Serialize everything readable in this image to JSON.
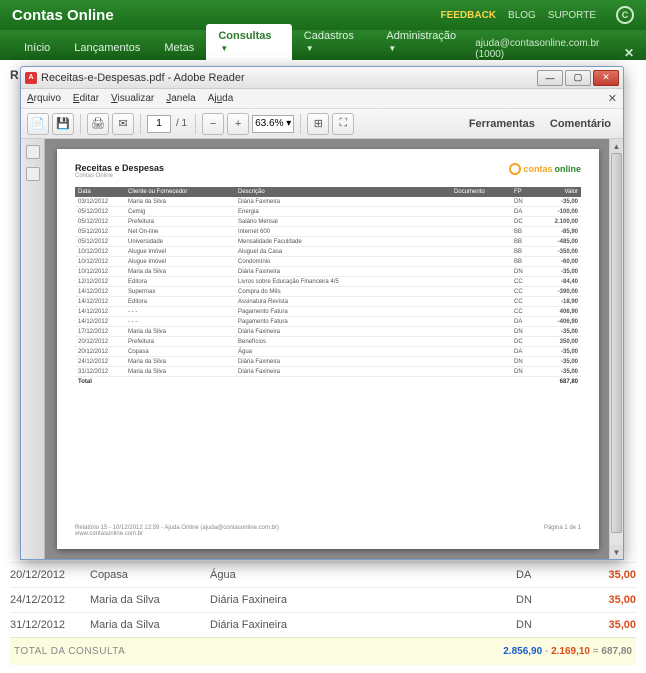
{
  "header": {
    "app_title": "Contas Online",
    "links": {
      "feedback": "FEEDBACK",
      "blog": "BLOG",
      "suporte": "SUPORTE"
    }
  },
  "nav": {
    "items": [
      {
        "label": "Início"
      },
      {
        "label": "Lançamentos"
      },
      {
        "label": "Metas"
      },
      {
        "label": "Consultas",
        "active": true,
        "dd": true
      },
      {
        "label": "Cadastros",
        "dd": true
      },
      {
        "label": "Administração",
        "dd": true
      }
    ],
    "user": "ajuda@contasonline.com.br (1000)"
  },
  "page": {
    "title_prefix": "R"
  },
  "bg_rows": [
    {
      "date": "20/12/2012",
      "who": "Copasa",
      "desc": "Água",
      "fp": "DA",
      "val": "35,00"
    },
    {
      "date": "24/12/2012",
      "who": "Maria da Silva",
      "desc": "Diária Faxineira",
      "fp": "DN",
      "val": "35,00"
    },
    {
      "date": "31/12/2012",
      "who": "Maria da Silva",
      "desc": "Diária Faxineira",
      "fp": "DN",
      "val": "35,00"
    }
  ],
  "total": {
    "label": "TOTAL DA CONSULTA",
    "pos": "2.856,90",
    "sep1": " - ",
    "neg": "2.169,10",
    "sep2": " = ",
    "tot": "687,80"
  },
  "pdf": {
    "title": "Receitas-e-Despesas.pdf - Adobe Reader",
    "menu": {
      "arquivo": "Arquivo",
      "editar": "Editar",
      "visualizar": "Visualizar",
      "janela": "Janela",
      "ajuda": "Ajuda"
    },
    "page_current": "1",
    "page_total": "/ 1",
    "zoom": "63.6%",
    "tb": {
      "ferramentas": "Ferramentas",
      "comentario": "Comentário"
    },
    "paper": {
      "title": "Receitas e Despesas",
      "sub": "Contas Online",
      "headers": {
        "data": "Data",
        "cliente": "Cliente ou Fornecedor",
        "desc": "Descrição",
        "doc": "Documento",
        "fp": "FP",
        "valor": "Valor"
      },
      "rows": [
        {
          "d": "03/12/2012",
          "c": "Maria da Silva",
          "desc": "Diária Faxineira",
          "doc": "",
          "fp": "DN",
          "v": "-35,00",
          "cls": "v-red"
        },
        {
          "d": "05/12/2012",
          "c": "Cemig",
          "desc": "Energia",
          "doc": "",
          "fp": "DA",
          "v": "-100,00",
          "cls": "v-red"
        },
        {
          "d": "05/12/2012",
          "c": "Prefeitura",
          "desc": "Salário Mensal",
          "doc": "",
          "fp": "DC",
          "v": "2.100,00",
          "cls": "v-blue"
        },
        {
          "d": "05/12/2012",
          "c": "Net On-line",
          "desc": "Internet 600",
          "doc": "",
          "fp": "BB",
          "v": "-85,90",
          "cls": "v-red"
        },
        {
          "d": "05/12/2012",
          "c": "Universidade",
          "desc": "Mensalidade Faculdade",
          "doc": "",
          "fp": "BB",
          "v": "-485,00",
          "cls": "v-red"
        },
        {
          "d": "10/12/2012",
          "c": "Alugue Imóvel",
          "desc": "Aluguel da Casa",
          "doc": "",
          "fp": "BB",
          "v": "-350,00",
          "cls": "v-red"
        },
        {
          "d": "10/12/2012",
          "c": "Alugue Imóvel",
          "desc": "Condomínio",
          "doc": "",
          "fp": "BB",
          "v": "-60,00",
          "cls": "v-red"
        },
        {
          "d": "10/12/2012",
          "c": "Maria da Silva",
          "desc": "Diária Faxineira",
          "doc": "",
          "fp": "DN",
          "v": "-35,00",
          "cls": "v-red"
        },
        {
          "d": "12/12/2012",
          "c": "Editora",
          "desc": "Livros sobre Educação Financeira 4/5",
          "doc": "",
          "fp": "CC",
          "v": "-84,40",
          "cls": "v-red"
        },
        {
          "d": "14/12/2012",
          "c": "Supermax",
          "desc": "Compra do Mês",
          "doc": "",
          "fp": "CC",
          "v": "-390,00",
          "cls": "v-red"
        },
        {
          "d": "14/12/2012",
          "c": "Editora",
          "desc": "Assinatura Revista",
          "doc": "",
          "fp": "CC",
          "v": "-18,90",
          "cls": "v-red"
        },
        {
          "d": "14/12/2012",
          "c": "- - -",
          "desc": "Pagamento Fatura",
          "doc": "",
          "fp": "CC",
          "v": "406,90",
          "cls": "v-blue"
        },
        {
          "d": "14/12/2012",
          "c": "- - -",
          "desc": "Pagamento Fatura",
          "doc": "",
          "fp": "DA",
          "v": "-406,90",
          "cls": "v-red"
        },
        {
          "d": "17/12/2012",
          "c": "Maria da Silva",
          "desc": "Diária Faxineira",
          "doc": "",
          "fp": "DN",
          "v": "-35,00",
          "cls": "v-red"
        },
        {
          "d": "20/12/2012",
          "c": "Prefeitura",
          "desc": "Benefícios",
          "doc": "",
          "fp": "DC",
          "v": "350,00",
          "cls": "v-blue"
        },
        {
          "d": "20/12/2012",
          "c": "Copasa",
          "desc": "Água",
          "doc": "",
          "fp": "DA",
          "v": "-35,00",
          "cls": "v-red"
        },
        {
          "d": "24/12/2012",
          "c": "Maria da Silva",
          "desc": "Diária Faxineira",
          "doc": "",
          "fp": "DN",
          "v": "-35,00",
          "cls": "v-red"
        },
        {
          "d": "31/12/2012",
          "c": "Maria da Silva",
          "desc": "Diária Faxineira",
          "doc": "",
          "fp": "DN",
          "v": "-35,00",
          "cls": "v-red"
        }
      ],
      "total_label": "Total",
      "total_value": "687,80",
      "footer_left": "Relatório 15 - 10/12/2012 12:59 - Ajuda Online (ajuda@contasonline.com.br)",
      "footer_url": "www.contasonline.com.br",
      "footer_right": "Página 1 de 1"
    }
  }
}
